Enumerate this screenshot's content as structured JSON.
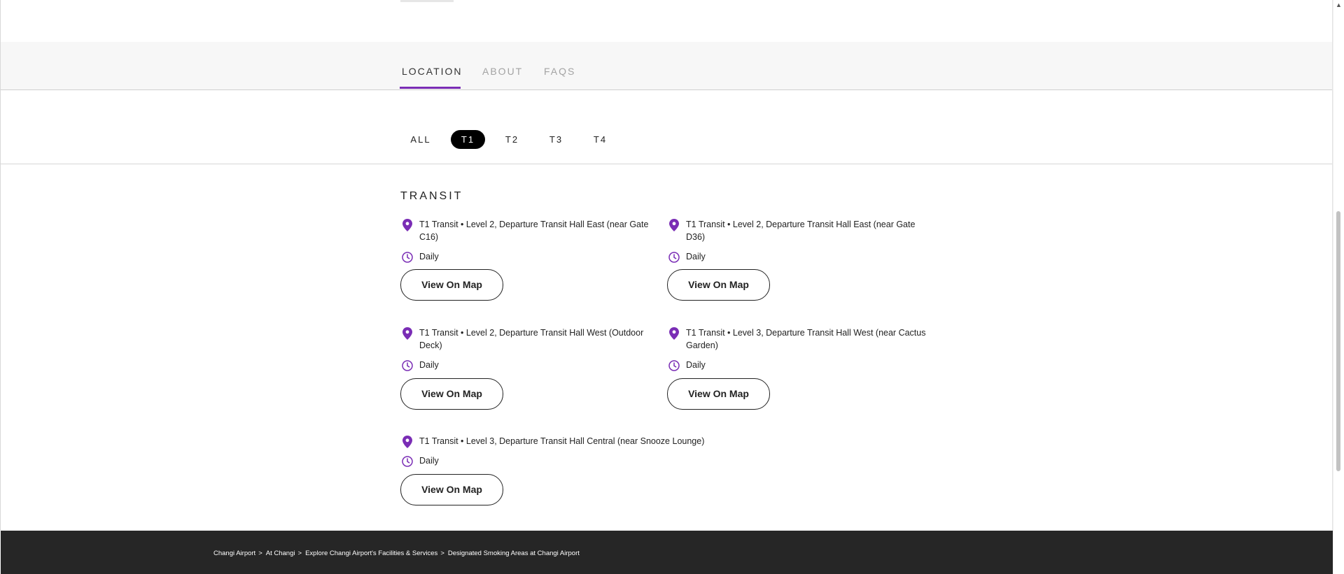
{
  "tabs": [
    {
      "label": "LOCATION",
      "active": true
    },
    {
      "label": "ABOUT",
      "active": false
    },
    {
      "label": "FAQS",
      "active": false
    }
  ],
  "filters": [
    {
      "label": "ALL",
      "active": false
    },
    {
      "label": "T1",
      "active": true
    },
    {
      "label": "T2",
      "active": false
    },
    {
      "label": "T3",
      "active": false
    },
    {
      "label": "T4",
      "active": false
    }
  ],
  "section": {
    "title": "TRANSIT"
  },
  "locations": [
    {
      "text": "T1 Transit • Level 2, Departure Transit Hall East (near Gate C16)",
      "hours": "Daily",
      "button": "View On Map"
    },
    {
      "text": "T1 Transit • Level 2, Departure Transit Hall East (near Gate D36)",
      "hours": "Daily",
      "button": "View On Map"
    },
    {
      "text": "T1 Transit • Level 2, Departure Transit Hall West (Outdoor Deck)",
      "hours": "Daily",
      "button": "View On Map"
    },
    {
      "text": "T1 Transit • Level 3, Departure Transit Hall West (near Cactus Garden)",
      "hours": "Daily",
      "button": "View On Map"
    },
    {
      "text": "T1 Transit • Level 3, Departure Transit Hall Central (near Snooze Lounge)",
      "hours": "Daily",
      "button": "View On Map"
    }
  ],
  "breadcrumb": [
    "Changi Airport",
    "At Changi",
    "Explore Changi Airport's Facilities & Services",
    "Designated Smoking Areas at Changi Airport"
  ],
  "breadcrumb_separator": ">",
  "colors": {
    "accent": "#7a2db5",
    "pill_active": "#000000",
    "footer_bg": "#262626",
    "tabbar_bg": "#f7f7f7"
  },
  "icons": {
    "location": "map-pin-icon",
    "hours": "clock-icon"
  }
}
